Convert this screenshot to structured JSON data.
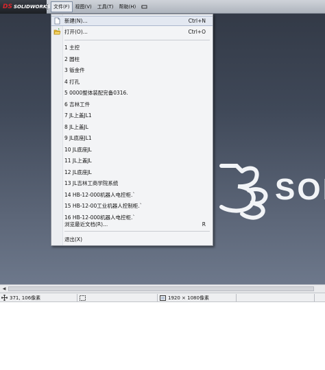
{
  "app": {
    "logo_mark": "DS",
    "logo_text": "SOLIDWORKS",
    "brand_word": "SOLI"
  },
  "menubar": {
    "items": [
      "文件(F)",
      "视图(V)",
      "工具(T)",
      "帮助(H)"
    ],
    "active_index": 0
  },
  "file_menu": {
    "new_label": "新建(N)...",
    "new_shortcut": "Ctrl+N",
    "open_label": "打开(O)...",
    "open_shortcut": "Ctrl+O",
    "recent_files": [
      "1 主控",
      "2 圆柱",
      "3 钣金件",
      "4 打孔",
      "5 0000整体装配完备0316.",
      "6 吉林工件",
      "7 JL上盖JL1",
      "8 JL上盖JL",
      "9 JL底座JL1",
      "10 JL底座JL",
      "11 JL上盖JL",
      "12 JL底座JL",
      "13 JL吉林工商学院系统",
      "14 HB-12-000机器人电控柜.`",
      "15 HB-12-00工业机器人控制柜.`",
      "16 HB-12-000机器人电控柜.`"
    ],
    "browse_recent_label": "浏览最近文档(R)...",
    "browse_recent_shortcut": "R",
    "exit_label": "退出(X)"
  },
  "statusbar": {
    "cursor_position": "371, 106像素",
    "image_size": "1920 × 1080像素"
  },
  "colors": {
    "logo_red": "#d8262b",
    "viewport_top": "#333a47",
    "viewport_bottom": "#6d788b",
    "menu_highlight": "#e3e8f1"
  }
}
